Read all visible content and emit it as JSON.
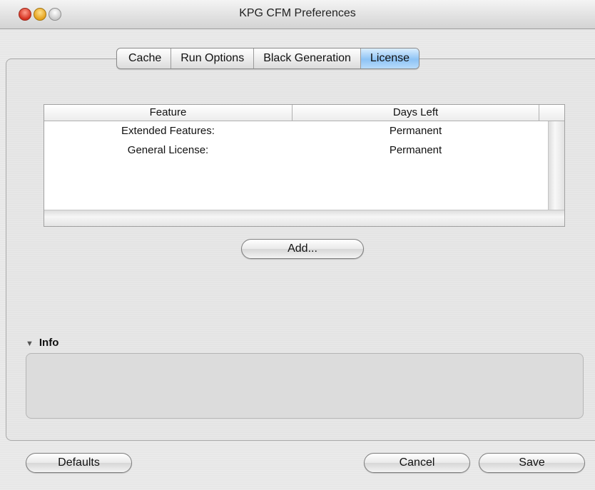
{
  "window": {
    "title": "KPG CFM Preferences"
  },
  "tabs": [
    {
      "label": "Cache",
      "active": false
    },
    {
      "label": "Run Options",
      "active": false
    },
    {
      "label": "Black Generation",
      "active": false
    },
    {
      "label": "License",
      "active": true
    }
  ],
  "license_table": {
    "columns": [
      "Feature",
      "Days Left"
    ],
    "rows": [
      {
        "feature": "Extended Features:",
        "days_left": "Permanent"
      },
      {
        "feature": "General License:",
        "days_left": "Permanent"
      }
    ]
  },
  "buttons": {
    "add": "Add...",
    "defaults": "Defaults",
    "cancel": "Cancel",
    "save": "Save"
  },
  "info": {
    "label": "Info",
    "expanded": true,
    "content": ""
  },
  "colors": {
    "active_tab": "#8ec3f5",
    "close": "#d4301f",
    "minimize": "#e5a11c"
  }
}
